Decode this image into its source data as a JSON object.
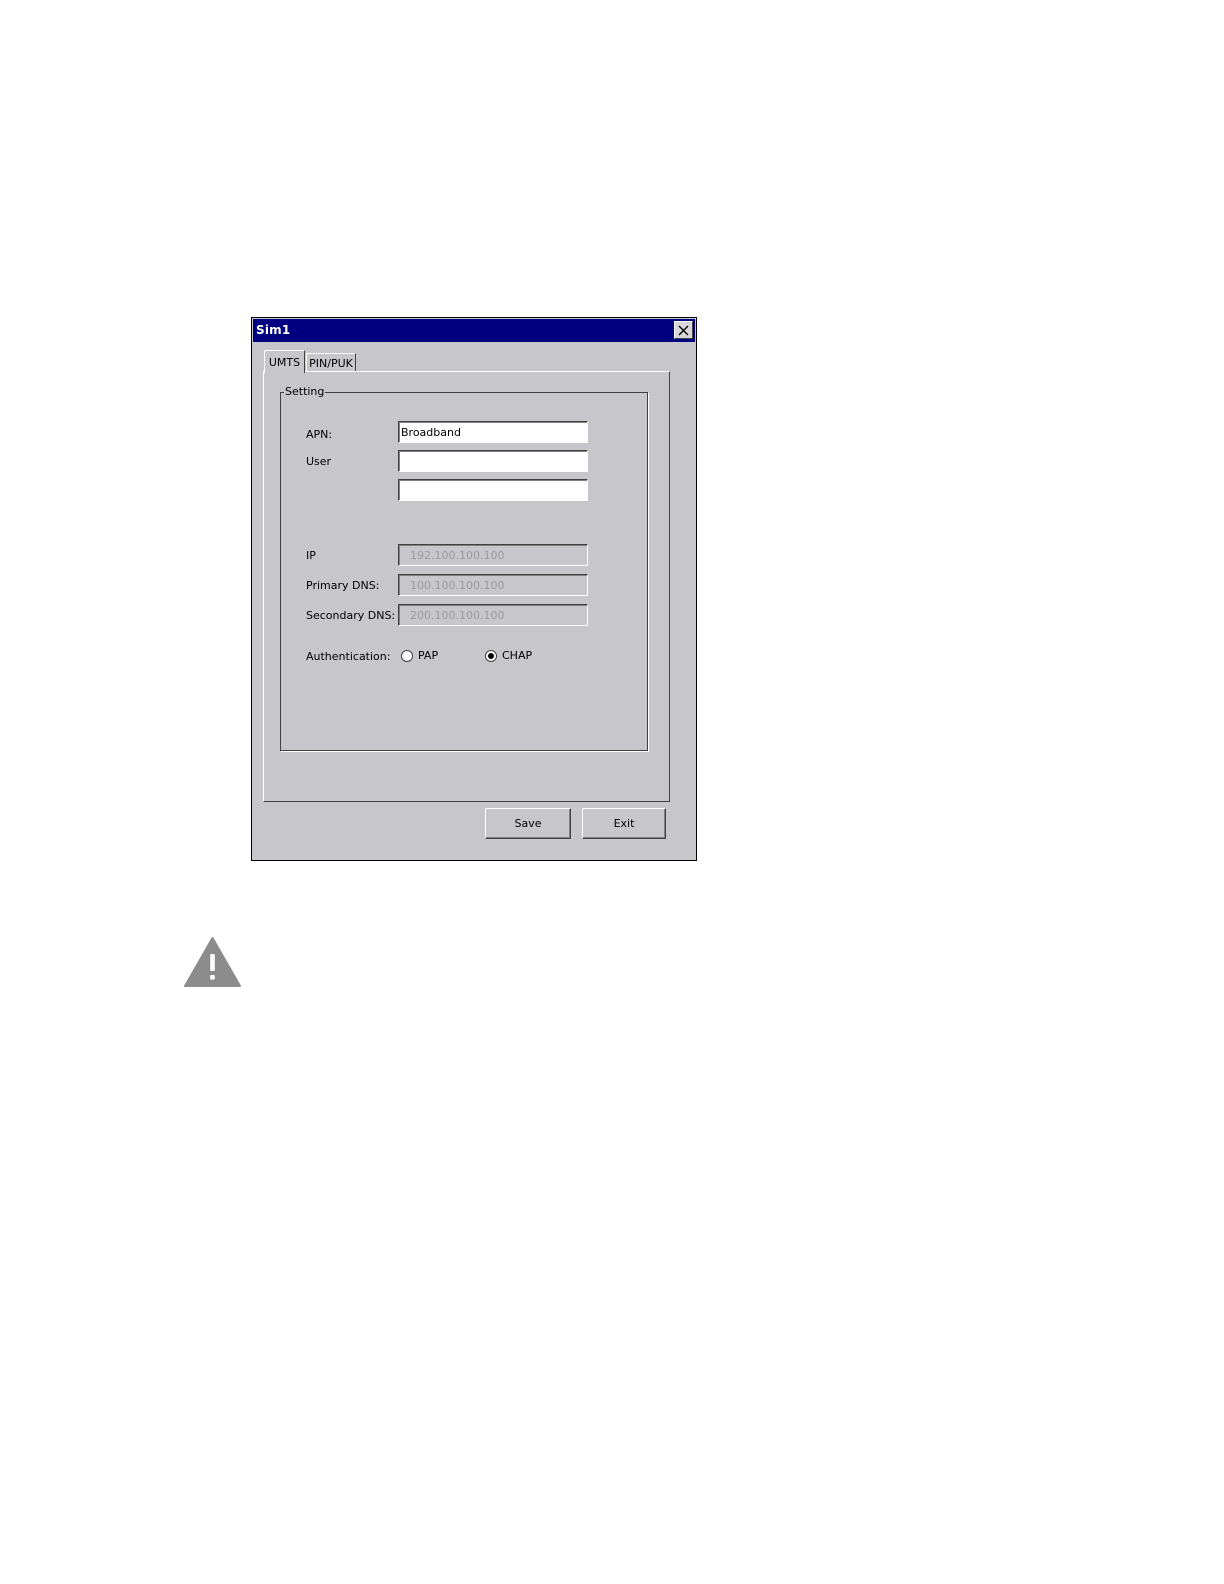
{
  "window": {
    "title": "Sim1",
    "close_glyph": "✕"
  },
  "tabs": [
    {
      "label": "UMTS",
      "active": true
    },
    {
      "label": "PIN/PUK",
      "active": false
    }
  ],
  "group": {
    "legend": "Setting"
  },
  "fields": {
    "apn_label": "APN:",
    "apn_value": "Broadband",
    "user_label": "User",
    "user_value": "",
    "password_value": "",
    "ip_label": "IP",
    "ip_value": "192.100.100.100",
    "primary_dns_label": "Primary DNS:",
    "primary_dns_value": "100.100.100.100",
    "secondary_dns_label": "Secondary DNS:",
    "secondary_dns_value": "200.100.100.100"
  },
  "authentication": {
    "label": "Authentication:",
    "options": [
      {
        "label": "PAP",
        "selected": false
      },
      {
        "label": "CHAP",
        "selected": true
      }
    ]
  },
  "buttons": {
    "save_label": "Save",
    "exit_label": "Exit"
  },
  "icons": {
    "close": "close-icon",
    "caution": "caution-icon"
  },
  "colors": {
    "titlebar": "#000080",
    "dialog_face": "#c7c6cb",
    "caution_fill": "#8c8c8c"
  }
}
